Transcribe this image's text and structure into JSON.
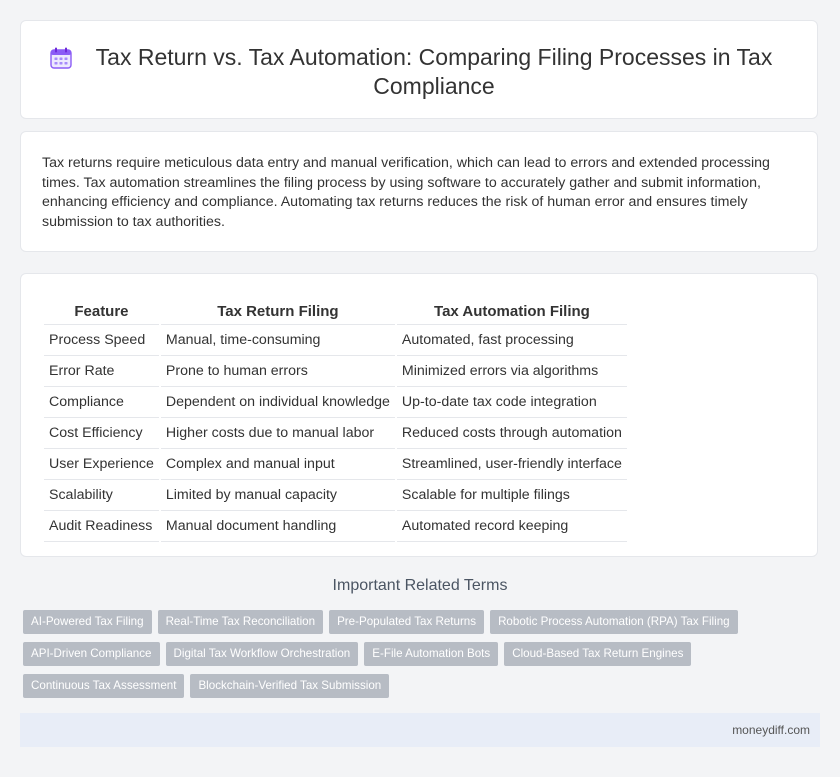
{
  "header": {
    "title": "Tax Return vs. Tax Automation: Comparing Filing Processes in Tax Compliance",
    "icon": "calendar-icon"
  },
  "intro": {
    "text": "Tax returns require meticulous data entry and manual verification, which can lead to errors and extended processing times. Tax automation streamlines the filing process by using software to accurately gather and submit information, enhancing efficiency and compliance. Automating tax returns reduces the risk of human error and ensures timely submission to tax authorities."
  },
  "comparison": {
    "headers": [
      "Feature",
      "Tax Return Filing",
      "Tax Automation Filing"
    ],
    "rows": [
      [
        "Process Speed",
        "Manual, time-consuming",
        "Automated, fast processing"
      ],
      [
        "Error Rate",
        "Prone to human errors",
        "Minimized errors via algorithms"
      ],
      [
        "Compliance",
        "Dependent on individual knowledge",
        "Up-to-date tax code integration"
      ],
      [
        "Cost Efficiency",
        "Higher costs due to manual labor",
        "Reduced costs through automation"
      ],
      [
        "User Experience",
        "Complex and manual input",
        "Streamlined, user-friendly interface"
      ],
      [
        "Scalability",
        "Limited by manual capacity",
        "Scalable for multiple filings"
      ],
      [
        "Audit Readiness",
        "Manual document handling",
        "Automated record keeping"
      ]
    ]
  },
  "related": {
    "title": "Important Related Terms",
    "tags": [
      [
        "AI-Powered Tax Filing",
        "Real-Time Tax Reconciliation",
        "Pre-Populated Tax Returns",
        "Robotic Process Automation (RPA) Tax Filing"
      ],
      [
        "API-Driven Compliance",
        "Digital Tax Workflow Orchestration",
        "E-File Automation Bots",
        "Cloud-Based Tax Return Engines"
      ],
      [
        "Continuous Tax Assessment",
        "Blockchain-Verified Tax Submission"
      ]
    ]
  },
  "footer": {
    "site": "moneydiff.com"
  }
}
